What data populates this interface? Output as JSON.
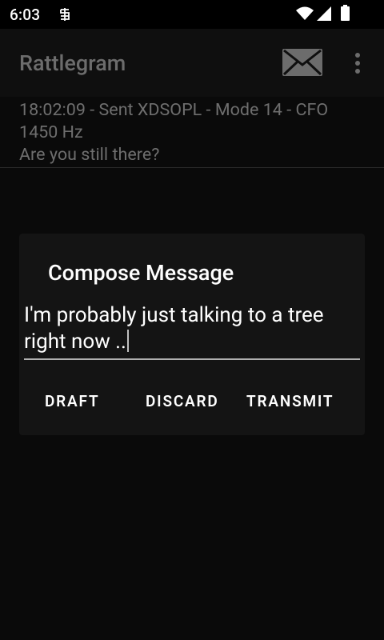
{
  "status_bar": {
    "time": "6:03",
    "icons": [
      "notification-icon",
      "wifi-icon",
      "signal-icon",
      "battery-icon"
    ]
  },
  "app_bar": {
    "title": "Rattlegram",
    "actions": [
      "mail-icon",
      "overflow-menu-icon"
    ]
  },
  "messages": [
    {
      "header": "18:02:09 - Sent XDSOPL - Mode 14 - CFO 1450 Hz",
      "body": "Are you still there?"
    }
  ],
  "dialog": {
    "title": "Compose Message",
    "input_value": "I'm probably just talking to a tree right now ..",
    "buttons": {
      "draft": "DRAFT",
      "discard": "DISCARD",
      "transmit": "TRANSMIT"
    }
  },
  "colors": {
    "background": "#0a0a0a",
    "dialog_background": "#141414",
    "dimmed_text": "#6e6e6e",
    "text": "#ffffff"
  }
}
